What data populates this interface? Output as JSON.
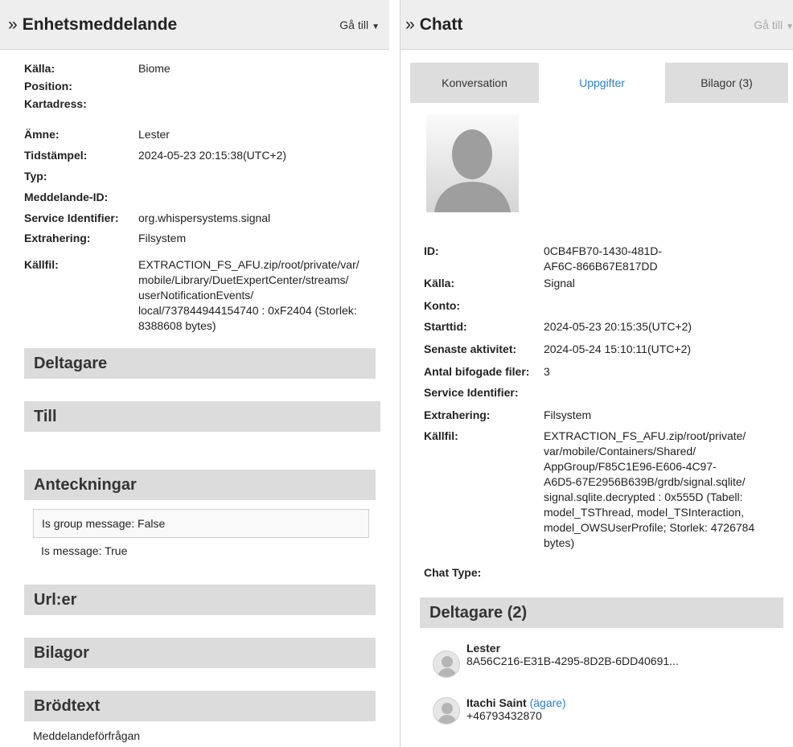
{
  "left": {
    "title": "Enhetsmeddelande",
    "goto": "Gå till",
    "fields": [
      {
        "key": "Källa:",
        "value": "Biome"
      },
      {
        "key": "Position:",
        "value": ""
      },
      {
        "key": "Kartadress:",
        "value": ""
      },
      {
        "key": "Ämne:",
        "value": "Lester"
      },
      {
        "key": "Tidstämpel:",
        "value": "2024-05-23 20:15:38(UTC+2)"
      },
      {
        "key": "Typ:",
        "value": ""
      },
      {
        "key": "Meddelande-ID:",
        "value": ""
      },
      {
        "key": "Service Identifier:",
        "value": "org.whispersystems.signal"
      },
      {
        "key": "Extrahering:",
        "value": "Filsystem"
      }
    ],
    "source_key": "Källfil:",
    "source_lines": [
      "EXTRACTION_FS_AFU.zip/root/private/var/",
      "mobile/Library/DuetExpertCenter/streams/",
      "userNotificationEvents/",
      "local/737844944154740 : 0xF2404 (Storlek:",
      "8388608 bytes)"
    ],
    "sections": {
      "participants": "Deltagare",
      "to": "Till",
      "notes": "Anteckningar",
      "urls": "Url:er",
      "attachments": "Bilagor",
      "body": "Brödtext"
    },
    "notes": [
      "Is group message: False",
      "Is message: True"
    ],
    "body_text": "Meddelandeförfrågan"
  },
  "right": {
    "title": "Chatt",
    "goto": "Gå till",
    "tabs": [
      "Konversation",
      "Uppgifter",
      "Bilagor (3)"
    ],
    "id_key": "ID:",
    "id_lines": [
      "0CB4FB70-1430-481D-",
      "AF6C-866B67E817DD"
    ],
    "fields": [
      {
        "key": "Källa:",
        "value": "Signal"
      },
      {
        "key": "Konto:",
        "value": ""
      },
      {
        "key": "Starttid:",
        "value": "2024-05-23 20:15:35(UTC+2)"
      },
      {
        "key": "Senaste aktivitet:",
        "value": "2024-05-24 15:10:11(UTC+2)"
      },
      {
        "key": "Antal bifogade filer:",
        "value": "3"
      },
      {
        "key": "Service Identifier:",
        "value": ""
      },
      {
        "key": "Extrahering:",
        "value": "Filsystem"
      }
    ],
    "source_key": "Källfil:",
    "source_lines": [
      "EXTRACTION_FS_AFU.zip/root/private/",
      "var/mobile/Containers/Shared/",
      "AppGroup/F85C1E96-E606-4C97-",
      "A6D5-67E2956B639B/grdb/signal.sqlite/",
      "signal.sqlite.decrypted : 0x555D (Tabell:",
      "model_TSThread, model_TSInteraction,",
      "model_OWSUserProfile; Storlek: 4726784",
      "bytes)"
    ],
    "chat_type_key": "Chat Type:",
    "participants_title": "Deltagare (2)",
    "participants": [
      {
        "name": "Lester",
        "owner": "",
        "id": "8A56C216-E31B-4295-8D2B-6DD40691..."
      },
      {
        "name": "Itachi Saint",
        "owner": "(ägare)",
        "id": "+46793432870"
      }
    ]
  }
}
